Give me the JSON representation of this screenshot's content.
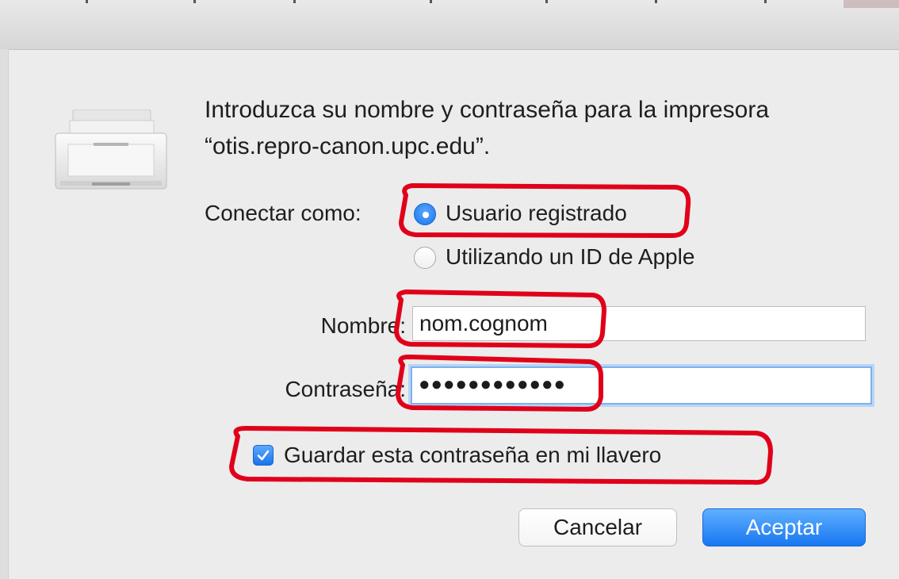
{
  "dialog": {
    "message": "Introduzca su nombre y contraseña para la impresora “otis.repro-canon.upc.edu”."
  },
  "connect": {
    "label": "Conectar como:",
    "options": [
      {
        "label": "Usuario registrado",
        "selected": true
      },
      {
        "label": "Utilizando un ID de Apple",
        "selected": false
      }
    ]
  },
  "form": {
    "name_label": "Nombre:",
    "name_value": "nom.cognom",
    "password_label": "Contraseña:",
    "password_mask": "●●●●●●●●●●●●",
    "remember_label": "Guardar esta contraseña en mi llavero",
    "remember_checked": true
  },
  "buttons": {
    "cancel": "Cancelar",
    "accept": "Aceptar"
  },
  "colors": {
    "accent": "#1a73e8",
    "annotation": "#e0001a"
  },
  "icons": [
    "printer-icon",
    "checkmark-icon"
  ]
}
